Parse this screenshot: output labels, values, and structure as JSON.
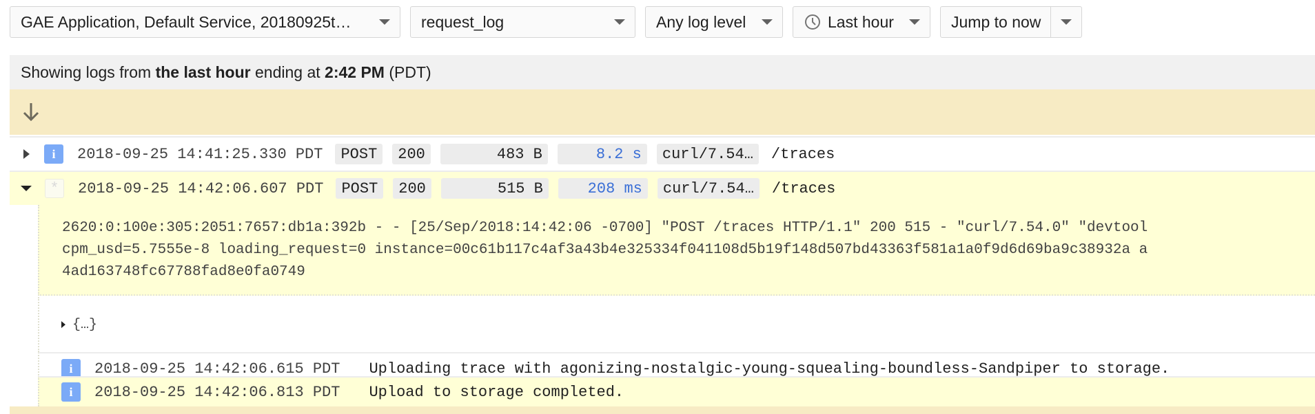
{
  "toolbar": {
    "resource": "GAE Application, Default Service, 20180925t…",
    "log_name": "request_log",
    "log_level": "Any log level",
    "time_range": "Last hour",
    "jump": "Jump to now"
  },
  "banner": {
    "prefix": "Showing logs from ",
    "range": "the last hour",
    "middle": " ending at ",
    "time": "2:42 PM",
    "suffix": " (PDT)"
  },
  "entries": [
    {
      "expanded": false,
      "severity": "info",
      "severity_glyph": "i",
      "timestamp": "2018-09-25 14:41:25.330 PDT",
      "method": "POST",
      "status": "200",
      "size": "483 B",
      "latency": "8.2 s",
      "user_agent": "curl/7.54…",
      "path": "/traces"
    },
    {
      "expanded": true,
      "severity": "any",
      "severity_glyph": "*",
      "timestamp": "2018-09-25 14:42:06.607 PDT",
      "method": "POST",
      "status": "200",
      "size": "515 B",
      "latency": "208 ms",
      "user_agent": "curl/7.54…",
      "path": "/traces",
      "details_lines": [
        "2620:0:100e:305:2051:7657:db1a:392b - - [25/Sep/2018:14:42:06 -0700] \"POST /traces HTTP/1.1\" 200 515 - \"curl/7.54.0\" \"devtool",
        "cpm_usd=5.7555e-8 loading_request=0 instance=00c61b117c4af3a43b4e325334f041108d5b19f148d507bd43363f581a1a0f9d6d69ba9c38932a a",
        "4ad163748fc67788fad8e0fa0749"
      ],
      "json_toggle": "{…}",
      "child_logs": [
        {
          "severity_glyph": "i",
          "timestamp": "2018-09-25 14:42:06.615 PDT",
          "message": "Uploading trace with agonizing-nostalgic-young-squealing-boundless-Sandpiper to storage."
        },
        {
          "severity_glyph": "i",
          "timestamp": "2018-09-25 14:42:06.813 PDT",
          "message": "Upload to storage completed."
        }
      ]
    }
  ],
  "colors": {
    "info_badge": "#7baaf7",
    "latency_text": "#3a6fd6",
    "highlight_row": "#ffffd6",
    "older_bar": "#f7ebc4",
    "banner_bg": "#f1f1f1"
  }
}
